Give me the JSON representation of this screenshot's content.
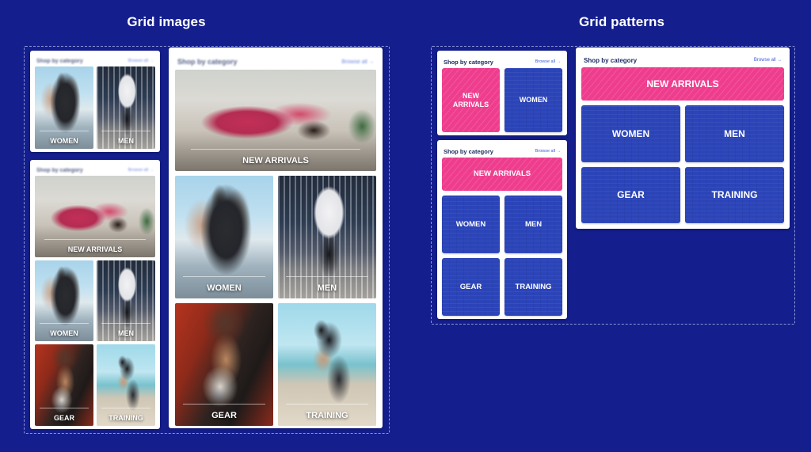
{
  "page": {
    "background_color": "#141e8c",
    "accent_pink": "#ef3d8e",
    "accent_blue": "#2b44b8",
    "link_color": "#3a5bd9"
  },
  "panels": {
    "left": {
      "title": "Grid images"
    },
    "right": {
      "title": "Grid patterns"
    }
  },
  "card_header": {
    "title": "Shop by category",
    "browse_label": "Browse all",
    "browse_arrow": "→"
  },
  "labels": {
    "new_arrivals": "NEW ARRIVALS",
    "new_arrivals_two_line": "NEW\nARRIVALS",
    "women": "WOMEN",
    "men": "MEN",
    "gear": "GEAR",
    "training": "TRAINING"
  },
  "image_cards": [
    {
      "id": "images-2up",
      "header_title": "Shop by category",
      "browse_label": "Browse all",
      "tiles": [
        {
          "label": "WOMEN",
          "photo": "woman-black-tank-seaside"
        },
        {
          "label": "MEN",
          "photo": "man-white-hoodie-rooftop"
        }
      ]
    },
    {
      "id": "images-5up-narrow",
      "header_title": "Shop by category",
      "browse_label": "Browse all",
      "tiles": [
        {
          "label": "NEW ARRIVALS",
          "photo": "yoga-pink-leggings"
        },
        {
          "label": "WOMEN",
          "photo": "woman-black-tank-seaside"
        },
        {
          "label": "MEN",
          "photo": "man-white-hoodie-rooftop"
        },
        {
          "label": "GEAR",
          "photo": "smartwatch-red-tank"
        },
        {
          "label": "TRAINING",
          "photo": "beach-kick-training"
        }
      ]
    },
    {
      "id": "images-5up-wide",
      "header_title": "Shop by category",
      "browse_label": "Browse all",
      "tiles": [
        {
          "label": "NEW ARRIVALS",
          "photo": "yoga-pink-leggings"
        },
        {
          "label": "WOMEN",
          "photo": "woman-black-tank-seaside"
        },
        {
          "label": "MEN",
          "photo": "man-white-hoodie-rooftop"
        },
        {
          "label": "GEAR",
          "photo": "smartwatch-red-tank"
        },
        {
          "label": "TRAINING",
          "photo": "beach-kick-training"
        }
      ]
    }
  ],
  "pattern_cards": [
    {
      "id": "patterns-2up",
      "header_title": "Shop by category",
      "browse_label": "Browse all",
      "tiles": [
        {
          "label": "NEW\nARRIVALS",
          "color": "#ef3d8e",
          "pattern": "diagonal-stripes"
        },
        {
          "label": "WOMEN",
          "color": "#2b44b8",
          "pattern": "wave"
        }
      ]
    },
    {
      "id": "patterns-5up-narrow",
      "header_title": "Shop by category",
      "browse_label": "Browse all",
      "tiles": [
        {
          "label": "NEW ARRIVALS",
          "color": "#ef3d8e",
          "pattern": "diagonal-stripes"
        },
        {
          "label": "WOMEN",
          "color": "#2b44b8",
          "pattern": "wave"
        },
        {
          "label": "MEN",
          "color": "#2b44b8",
          "pattern": "wave"
        },
        {
          "label": "GEAR",
          "color": "#2b44b8",
          "pattern": "wave"
        },
        {
          "label": "TRAINING",
          "color": "#2b44b8",
          "pattern": "wave"
        }
      ]
    },
    {
      "id": "patterns-5up-wide",
      "header_title": "Shop by category",
      "browse_label": "Browse all",
      "tiles": [
        {
          "label": "NEW ARRIVALS",
          "color": "#ef3d8e",
          "pattern": "diagonal-stripes"
        },
        {
          "label": "WOMEN",
          "color": "#2b44b8",
          "pattern": "wave"
        },
        {
          "label": "MEN",
          "color": "#2b44b8",
          "pattern": "wave"
        },
        {
          "label": "GEAR",
          "color": "#2b44b8",
          "pattern": "wave"
        },
        {
          "label": "TRAINING",
          "color": "#2b44b8",
          "pattern": "wave"
        }
      ]
    }
  ]
}
